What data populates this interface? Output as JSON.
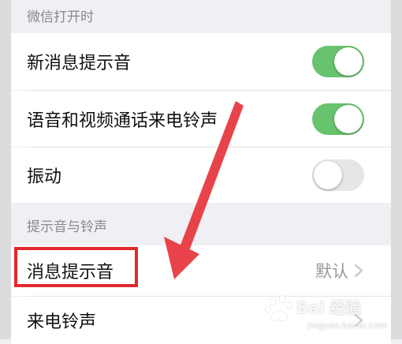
{
  "sections": [
    {
      "header": "微信打开时",
      "items": [
        {
          "label": "新消息提示音",
          "toggle": "on"
        },
        {
          "label": "语音和视频通话来电铃声",
          "toggle": "on"
        },
        {
          "label": "振动",
          "toggle": "off"
        }
      ]
    },
    {
      "header": "提示音与铃声",
      "items": [
        {
          "label": "消息提示音",
          "value": "默认",
          "chevron": "chevron-right-icon"
        },
        {
          "label": "来电铃声",
          "chevron": "chevron-right-icon"
        }
      ]
    }
  ],
  "annotation": {
    "highlight_color": "#e3272e",
    "arrow_color": "#e8434a"
  },
  "watermark": {
    "brand": "Bai 经验",
    "url": "jingyan.baidu.com"
  },
  "colors": {
    "toggle_on": "#67c36d",
    "toggle_off": "#e6e6e6",
    "background": "#efeff4"
  }
}
